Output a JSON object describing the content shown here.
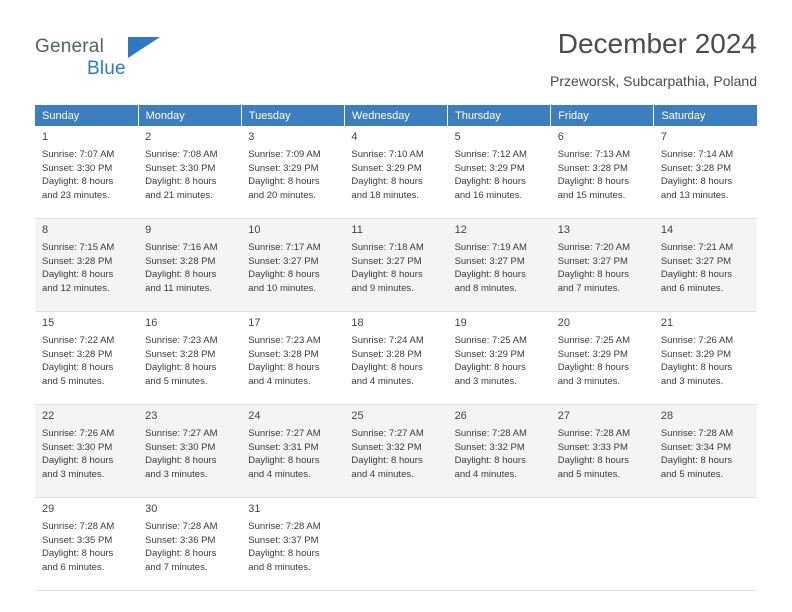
{
  "brand": {
    "name_part1": "General",
    "name_part2": "Blue",
    "accent_color": "#2f78c4"
  },
  "header": {
    "title": "December 2024",
    "location": "Przeworsk, Subcarpathia, Poland"
  },
  "calendar": {
    "weekday_headers": [
      "Sunday",
      "Monday",
      "Tuesday",
      "Wednesday",
      "Thursday",
      "Friday",
      "Saturday"
    ],
    "header_bg": "#3c7ebe",
    "weeks": [
      [
        {
          "day": "1",
          "sunrise": "Sunrise: 7:07 AM",
          "sunset": "Sunset: 3:30 PM",
          "daylight_line1": "Daylight: 8 hours",
          "daylight_line2": "and 23 minutes."
        },
        {
          "day": "2",
          "sunrise": "Sunrise: 7:08 AM",
          "sunset": "Sunset: 3:30 PM",
          "daylight_line1": "Daylight: 8 hours",
          "daylight_line2": "and 21 minutes."
        },
        {
          "day": "3",
          "sunrise": "Sunrise: 7:09 AM",
          "sunset": "Sunset: 3:29 PM",
          "daylight_line1": "Daylight: 8 hours",
          "daylight_line2": "and 20 minutes."
        },
        {
          "day": "4",
          "sunrise": "Sunrise: 7:10 AM",
          "sunset": "Sunset: 3:29 PM",
          "daylight_line1": "Daylight: 8 hours",
          "daylight_line2": "and 18 minutes."
        },
        {
          "day": "5",
          "sunrise": "Sunrise: 7:12 AM",
          "sunset": "Sunset: 3:29 PM",
          "daylight_line1": "Daylight: 8 hours",
          "daylight_line2": "and 16 minutes."
        },
        {
          "day": "6",
          "sunrise": "Sunrise: 7:13 AM",
          "sunset": "Sunset: 3:28 PM",
          "daylight_line1": "Daylight: 8 hours",
          "daylight_line2": "and 15 minutes."
        },
        {
          "day": "7",
          "sunrise": "Sunrise: 7:14 AM",
          "sunset": "Sunset: 3:28 PM",
          "daylight_line1": "Daylight: 8 hours",
          "daylight_line2": "and 13 minutes."
        }
      ],
      [
        {
          "day": "8",
          "sunrise": "Sunrise: 7:15 AM",
          "sunset": "Sunset: 3:28 PM",
          "daylight_line1": "Daylight: 8 hours",
          "daylight_line2": "and 12 minutes."
        },
        {
          "day": "9",
          "sunrise": "Sunrise: 7:16 AM",
          "sunset": "Sunset: 3:28 PM",
          "daylight_line1": "Daylight: 8 hours",
          "daylight_line2": "and 11 minutes."
        },
        {
          "day": "10",
          "sunrise": "Sunrise: 7:17 AM",
          "sunset": "Sunset: 3:27 PM",
          "daylight_line1": "Daylight: 8 hours",
          "daylight_line2": "and 10 minutes."
        },
        {
          "day": "11",
          "sunrise": "Sunrise: 7:18 AM",
          "sunset": "Sunset: 3:27 PM",
          "daylight_line1": "Daylight: 8 hours",
          "daylight_line2": "and 9 minutes."
        },
        {
          "day": "12",
          "sunrise": "Sunrise: 7:19 AM",
          "sunset": "Sunset: 3:27 PM",
          "daylight_line1": "Daylight: 8 hours",
          "daylight_line2": "and 8 minutes."
        },
        {
          "day": "13",
          "sunrise": "Sunrise: 7:20 AM",
          "sunset": "Sunset: 3:27 PM",
          "daylight_line1": "Daylight: 8 hours",
          "daylight_line2": "and 7 minutes."
        },
        {
          "day": "14",
          "sunrise": "Sunrise: 7:21 AM",
          "sunset": "Sunset: 3:27 PM",
          "daylight_line1": "Daylight: 8 hours",
          "daylight_line2": "and 6 minutes."
        }
      ],
      [
        {
          "day": "15",
          "sunrise": "Sunrise: 7:22 AM",
          "sunset": "Sunset: 3:28 PM",
          "daylight_line1": "Daylight: 8 hours",
          "daylight_line2": "and 5 minutes."
        },
        {
          "day": "16",
          "sunrise": "Sunrise: 7:23 AM",
          "sunset": "Sunset: 3:28 PM",
          "daylight_line1": "Daylight: 8 hours",
          "daylight_line2": "and 5 minutes."
        },
        {
          "day": "17",
          "sunrise": "Sunrise: 7:23 AM",
          "sunset": "Sunset: 3:28 PM",
          "daylight_line1": "Daylight: 8 hours",
          "daylight_line2": "and 4 minutes."
        },
        {
          "day": "18",
          "sunrise": "Sunrise: 7:24 AM",
          "sunset": "Sunset: 3:28 PM",
          "daylight_line1": "Daylight: 8 hours",
          "daylight_line2": "and 4 minutes."
        },
        {
          "day": "19",
          "sunrise": "Sunrise: 7:25 AM",
          "sunset": "Sunset: 3:29 PM",
          "daylight_line1": "Daylight: 8 hours",
          "daylight_line2": "and 3 minutes."
        },
        {
          "day": "20",
          "sunrise": "Sunrise: 7:25 AM",
          "sunset": "Sunset: 3:29 PM",
          "daylight_line1": "Daylight: 8 hours",
          "daylight_line2": "and 3 minutes."
        },
        {
          "day": "21",
          "sunrise": "Sunrise: 7:26 AM",
          "sunset": "Sunset: 3:29 PM",
          "daylight_line1": "Daylight: 8 hours",
          "daylight_line2": "and 3 minutes."
        }
      ],
      [
        {
          "day": "22",
          "sunrise": "Sunrise: 7:26 AM",
          "sunset": "Sunset: 3:30 PM",
          "daylight_line1": "Daylight: 8 hours",
          "daylight_line2": "and 3 minutes."
        },
        {
          "day": "23",
          "sunrise": "Sunrise: 7:27 AM",
          "sunset": "Sunset: 3:30 PM",
          "daylight_line1": "Daylight: 8 hours",
          "daylight_line2": "and 3 minutes."
        },
        {
          "day": "24",
          "sunrise": "Sunrise: 7:27 AM",
          "sunset": "Sunset: 3:31 PM",
          "daylight_line1": "Daylight: 8 hours",
          "daylight_line2": "and 4 minutes."
        },
        {
          "day": "25",
          "sunrise": "Sunrise: 7:27 AM",
          "sunset": "Sunset: 3:32 PM",
          "daylight_line1": "Daylight: 8 hours",
          "daylight_line2": "and 4 minutes."
        },
        {
          "day": "26",
          "sunrise": "Sunrise: 7:28 AM",
          "sunset": "Sunset: 3:32 PM",
          "daylight_line1": "Daylight: 8 hours",
          "daylight_line2": "and 4 minutes."
        },
        {
          "day": "27",
          "sunrise": "Sunrise: 7:28 AM",
          "sunset": "Sunset: 3:33 PM",
          "daylight_line1": "Daylight: 8 hours",
          "daylight_line2": "and 5 minutes."
        },
        {
          "day": "28",
          "sunrise": "Sunrise: 7:28 AM",
          "sunset": "Sunset: 3:34 PM",
          "daylight_line1": "Daylight: 8 hours",
          "daylight_line2": "and 5 minutes."
        }
      ],
      [
        {
          "day": "29",
          "sunrise": "Sunrise: 7:28 AM",
          "sunset": "Sunset: 3:35 PM",
          "daylight_line1": "Daylight: 8 hours",
          "daylight_line2": "and 6 minutes."
        },
        {
          "day": "30",
          "sunrise": "Sunrise: 7:28 AM",
          "sunset": "Sunset: 3:36 PM",
          "daylight_line1": "Daylight: 8 hours",
          "daylight_line2": "and 7 minutes."
        },
        {
          "day": "31",
          "sunrise": "Sunrise: 7:28 AM",
          "sunset": "Sunset: 3:37 PM",
          "daylight_line1": "Daylight: 8 hours",
          "daylight_line2": "and 8 minutes."
        },
        null,
        null,
        null,
        null
      ]
    ]
  }
}
